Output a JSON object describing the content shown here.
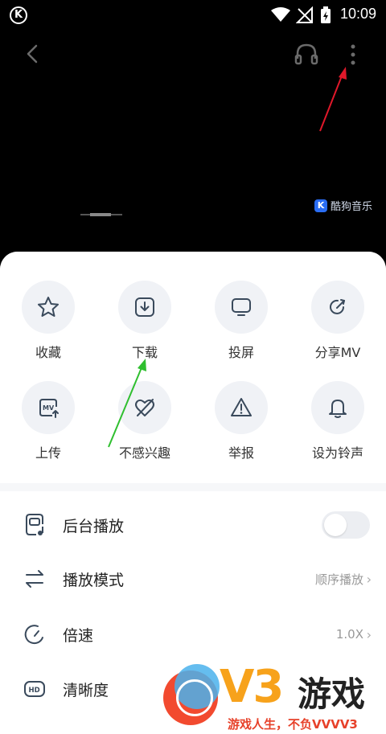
{
  "status_bar": {
    "app_logo": "K",
    "time": "10:09",
    "icons": [
      "wifi-icon",
      "no-signal-icon",
      "battery-charging-icon"
    ]
  },
  "video": {
    "nav_icons": [
      "back-icon",
      "headphone-icon",
      "more-icon"
    ],
    "watermark_badge": "K",
    "watermark_text": "酷狗音乐"
  },
  "actions": [
    {
      "label": "收藏",
      "icon": "star-icon"
    },
    {
      "label": "下载",
      "icon": "download-icon"
    },
    {
      "label": "投屏",
      "icon": "cast-screen-icon"
    },
    {
      "label": "分享MV",
      "icon": "share-icon"
    },
    {
      "label": "上传",
      "icon": "upload-mv-icon"
    },
    {
      "label": "不感兴趣",
      "icon": "not-interested-icon"
    },
    {
      "label": "举报",
      "icon": "warning-icon"
    },
    {
      "label": "设为铃声",
      "icon": "bell-icon"
    }
  ],
  "settings": [
    {
      "label": "后台播放",
      "icon": "background-play-icon",
      "toggle_on": false
    },
    {
      "label": "播放模式",
      "icon": "play-mode-icon",
      "value": "顺序播放"
    },
    {
      "label": "倍速",
      "icon": "speed-icon",
      "value": "1.0X"
    },
    {
      "label": "清晰度",
      "icon": "hd-icon"
    }
  ],
  "colors": {
    "accent_red_arrow": "#e0182a",
    "accent_green_arrow": "#2fbf2f",
    "icon_color": "#3a4a5c",
    "v3_orange": "#f7a21b"
  },
  "watermark_logo": {
    "brand": "V3",
    "name": "游戏",
    "slogan": "游戏人生，不负VVVV3"
  }
}
